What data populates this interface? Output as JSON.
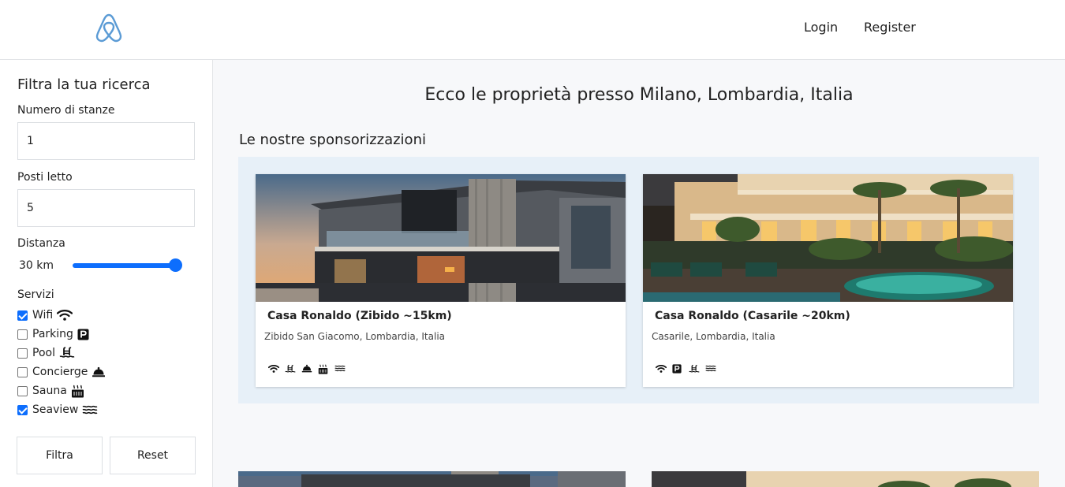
{
  "header": {
    "logo": "airbnb-logo",
    "login_label": "Login",
    "register_label": "Register"
  },
  "sidebar": {
    "title": "Filtra la tua ricerca",
    "rooms_label": "Numero di stanze",
    "rooms_value": "1",
    "beds_label": "Posti letto",
    "beds_value": "5",
    "distance_label": "Distanza",
    "distance_value": "30 km",
    "distance_slider_fraction": 1.0,
    "services_label": "Servizi",
    "services": [
      {
        "label": "Wifi",
        "checked": true,
        "icon": "wifi-icon"
      },
      {
        "label": "Parking",
        "checked": false,
        "icon": "parking-icon"
      },
      {
        "label": "Pool",
        "checked": false,
        "icon": "pool-icon"
      },
      {
        "label": "Concierge",
        "checked": false,
        "icon": "concierge-bell-icon"
      },
      {
        "label": "Sauna",
        "checked": false,
        "icon": "sauna-icon"
      },
      {
        "label": "Seaview",
        "checked": true,
        "icon": "water-icon"
      }
    ],
    "filter_label": "Filtra",
    "reset_label": "Reset"
  },
  "main": {
    "title": "Ecco le proprietà presso Milano, Lombardia, Italia",
    "sponsored_title": "Le nostre sponsorizzazioni",
    "cards": [
      {
        "title": "Casa Ronaldo (Zibido ~15km)",
        "address": "Zibido San Giacomo, Lombardia, Italia",
        "icons": [
          "wifi-icon",
          "pool-icon",
          "concierge-bell-icon",
          "sauna-icon",
          "water-icon"
        ]
      },
      {
        "title": "Casa Ronaldo (Casarile ~20km)",
        "address": "Casarile, Lombardia, Italia",
        "icons": [
          "wifi-icon",
          "parking-icon",
          "pool-icon",
          "water-icon"
        ]
      }
    ]
  },
  "colors": {
    "accent": "#0d6efd",
    "logo": "#5b9bd5",
    "sponsor_bg": "#e7f0f8",
    "page_bg": "#f7f8fa"
  }
}
